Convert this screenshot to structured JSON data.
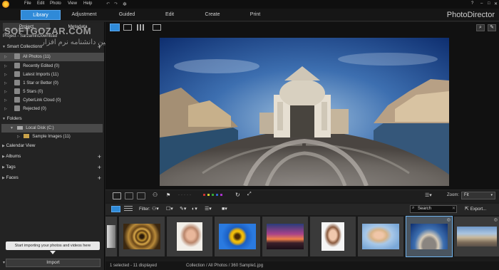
{
  "menu": [
    "File",
    "Edit",
    "Photo",
    "View",
    "Help"
  ],
  "modes": [
    {
      "label": "Library",
      "active": true
    },
    {
      "label": "Adjustment",
      "active": false
    },
    {
      "label": "Guided",
      "active": false
    },
    {
      "label": "Edit",
      "active": false
    },
    {
      "label": "Create",
      "active": false
    },
    {
      "label": "Print",
      "active": false
    }
  ],
  "brand": "PhotoDirector",
  "window_controls": [
    "?",
    "–",
    "□",
    "✕"
  ],
  "panel_tabs": [
    "Project",
    "Metadata"
  ],
  "project_label": "Project - SarzaminDownload",
  "watermark": "SOFTGOZAR.COM",
  "watermark_sub": "اولین دانشنامه نرم افزار",
  "smart_collections": {
    "title": "Smart Collections",
    "items": [
      {
        "label": "All Photos (11)",
        "selected": true
      },
      {
        "label": "Recently Edited (0)",
        "selected": false
      },
      {
        "label": "Latest Imports (11)",
        "selected": false
      },
      {
        "label": "1 Star or Better (0)",
        "selected": false
      },
      {
        "label": "5 Stars (0)",
        "selected": false
      },
      {
        "label": "CyberLink Cloud (0)",
        "selected": false
      },
      {
        "label": "Rejected (0)",
        "selected": false
      }
    ]
  },
  "folders": {
    "title": "Folders",
    "items": [
      {
        "label": "Local Disk (C:)",
        "selected": true
      },
      {
        "label": "Sample Images (11)",
        "selected": false
      }
    ]
  },
  "sections": [
    "Calendar View",
    "Albums",
    "Tags",
    "Faces"
  ],
  "tip": "Start importing your photos and videos here",
  "import_label": "Import",
  "zoom": {
    "label": "Zoom:",
    "value": "Fit"
  },
  "filter_label": "Filter:",
  "search_placeholder": "Search",
  "export_label": "Export...",
  "status": {
    "left": "1 selected - 11 displayed",
    "center": "Collection / All Photos / 360 Sample1.jpg"
  },
  "colors": {
    "accent": "#2f8ad8",
    "selection": "#6fb4ef"
  },
  "thumbnails": [
    {
      "name": "partial-left",
      "selected": false
    },
    {
      "name": "spiral-staircase",
      "selected": false
    },
    {
      "name": "woman-portrait",
      "selected": false
    },
    {
      "name": "sunflower",
      "selected": false
    },
    {
      "name": "sunset",
      "selected": false
    },
    {
      "name": "laughing-woman",
      "selected": false
    },
    {
      "name": "smiling-woman",
      "selected": false
    },
    {
      "name": "360-panorama",
      "selected": true
    },
    {
      "name": "venice-panorama",
      "selected": false
    }
  ]
}
